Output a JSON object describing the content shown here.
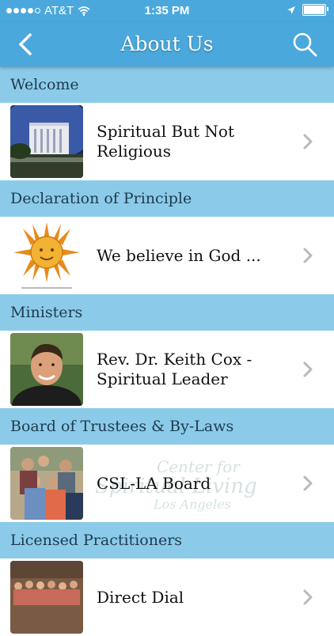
{
  "status_bar": {
    "carrier": "AT&T",
    "time": "1:35 PM"
  },
  "nav": {
    "title": "About Us"
  },
  "sections": [
    {
      "header": "Welcome",
      "label": "Spiritual But Not Religious",
      "thumb": "building-photo"
    },
    {
      "header": "Declaration of Principle",
      "label": "We believe in God ...",
      "thumb": "sun-drawing"
    },
    {
      "header": "Ministers",
      "label": "Rev. Dr. Keith Cox - Spiritual Leader",
      "thumb": "portrait-photo"
    },
    {
      "header": "Board of Trustees & By-Laws",
      "label": "CSL-LA Board",
      "thumb": "group-photo"
    },
    {
      "header": "Licensed Practitioners",
      "label": "Direct Dial",
      "thumb": "group-photo-2"
    }
  ],
  "watermark": {
    "line1": "Center for",
    "line2": "Spiritual Living",
    "line3": "Los Angeles"
  },
  "colors": {
    "bar": "#4aa8dc",
    "section_header": "#8bcbe9",
    "chevron": "#b9b9b9"
  }
}
